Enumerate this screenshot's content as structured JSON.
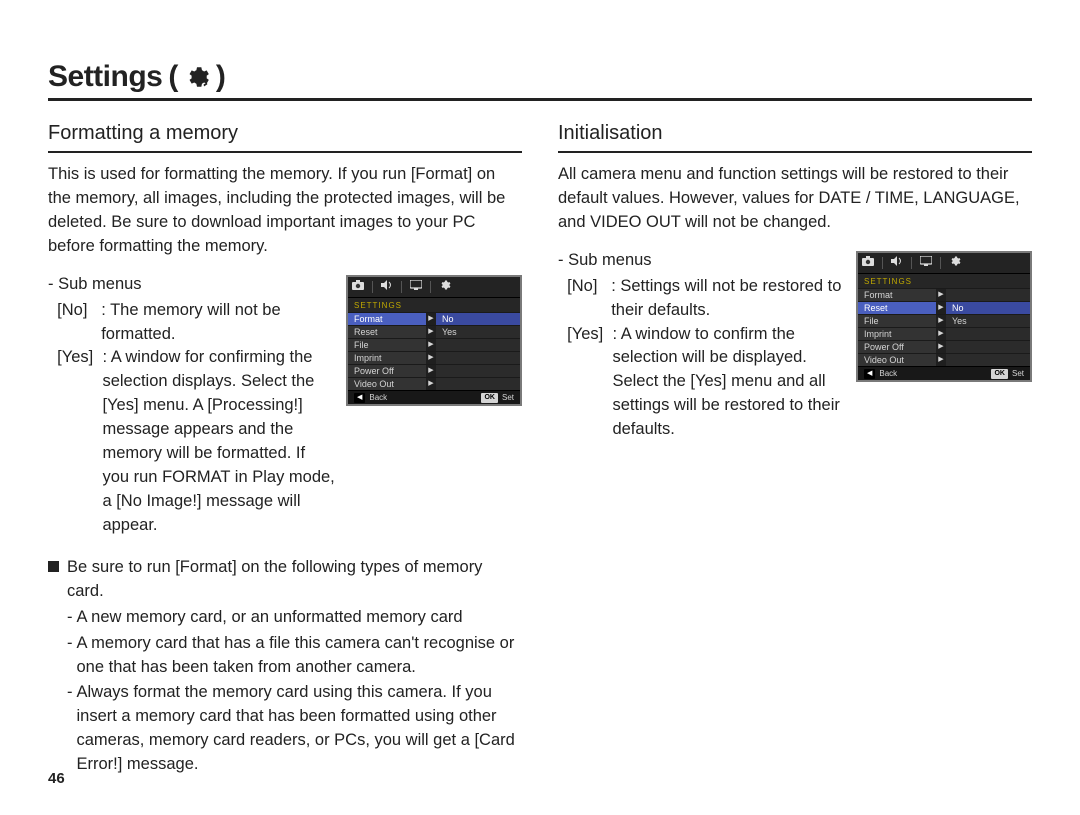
{
  "title": "Settings",
  "page_number": "46",
  "left": {
    "heading": "Formatting a memory",
    "intro": "This is used for formatting the memory. If you run [Format] on the memory, all images, including the protected images, will be deleted. Be sure to download important images to your PC before formatting the memory.",
    "submenus_label": "- Sub menus",
    "opt_no_key": "[No]",
    "opt_no_val": ": The memory will not be formatted.",
    "opt_yes_key": "[Yes]",
    "opt_yes_val": ": A window for confirming the selection displays. Select the [Yes] menu. A [Processing!] message appears and the memory will be formatted. If you run FORMAT in Play mode, a [No Image!] message will appear.",
    "tip_head": "Be sure to run [Format] on the following types of memory card.",
    "tip1": "A new memory card, or an unformatted memory card",
    "tip2": "A memory card that has a file this camera can't recognise or one that has been taken from another camera.",
    "tip3": "Always format the memory card using this camera. If you insert a memory card that has been formatted using other cameras, memory card readers, or PCs, you will get a [Card Error!] message.",
    "screen": {
      "title": "SETTINGS",
      "rows": [
        {
          "label": "Format",
          "value": "No",
          "selected": true
        },
        {
          "label": "Reset",
          "value": "Yes",
          "selected": false
        },
        {
          "label": "File",
          "value": "",
          "selected": false
        },
        {
          "label": "Imprint",
          "value": "",
          "selected": false
        },
        {
          "label": "Power Off",
          "value": "",
          "selected": false
        },
        {
          "label": "Video Out",
          "value": "",
          "selected": false
        }
      ],
      "back": "Back",
      "ok": "OK",
      "set": "Set"
    }
  },
  "right": {
    "heading": "Initialisation",
    "intro": "All camera menu and function settings will be restored to their default values. However, values for DATE / TIME, LANGUAGE, and VIDEO OUT will not be changed.",
    "submenus_label": "- Sub menus",
    "opt_no_key": "[No]",
    "opt_no_val": ": Settings will not be restored to their defaults.",
    "opt_yes_key": "[Yes]",
    "opt_yes_val": ": A window to confirm the selection will be displayed. Select the [Yes] menu and all settings will be restored to their defaults.",
    "screen": {
      "title": "SETTINGS",
      "rows": [
        {
          "label": "Format",
          "value": "",
          "selected": false
        },
        {
          "label": "Reset",
          "value": "No",
          "selected": true
        },
        {
          "label": "File",
          "value": "Yes",
          "selected": false
        },
        {
          "label": "Imprint",
          "value": "",
          "selected": false
        },
        {
          "label": "Power Off",
          "value": "",
          "selected": false
        },
        {
          "label": "Video Out",
          "value": "",
          "selected": false
        }
      ],
      "back": "Back",
      "ok": "OK",
      "set": "Set"
    }
  }
}
